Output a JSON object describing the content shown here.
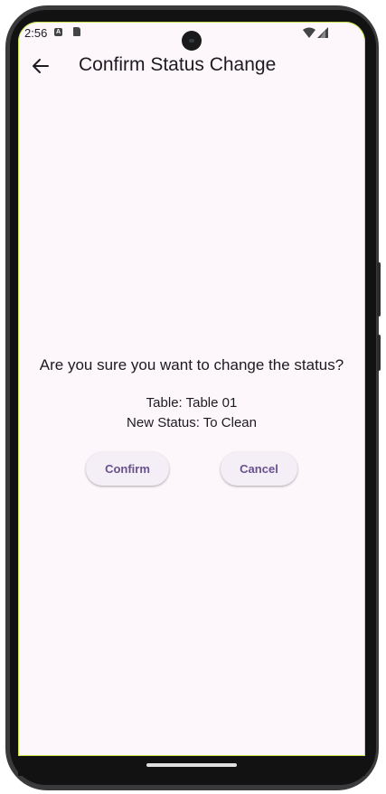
{
  "status_bar": {
    "time": "2:56",
    "icons": [
      "notification-a-icon",
      "sd-card-icon",
      "camera-icon",
      "wifi-icon",
      "signal-icon"
    ]
  },
  "app_bar": {
    "back_icon": "arrow-left-icon",
    "title": "Confirm Status Change"
  },
  "dialog": {
    "question": "Are you sure you want to change the status?",
    "table_line": "Table: Table 01",
    "status_line": "New Status: To Clean",
    "confirm_label": "Confirm",
    "cancel_label": "Cancel"
  },
  "colors": {
    "background": "#fdf7fc",
    "button_background": "#f4eef6",
    "button_text": "#67518e",
    "text": "#1c1b1f"
  }
}
